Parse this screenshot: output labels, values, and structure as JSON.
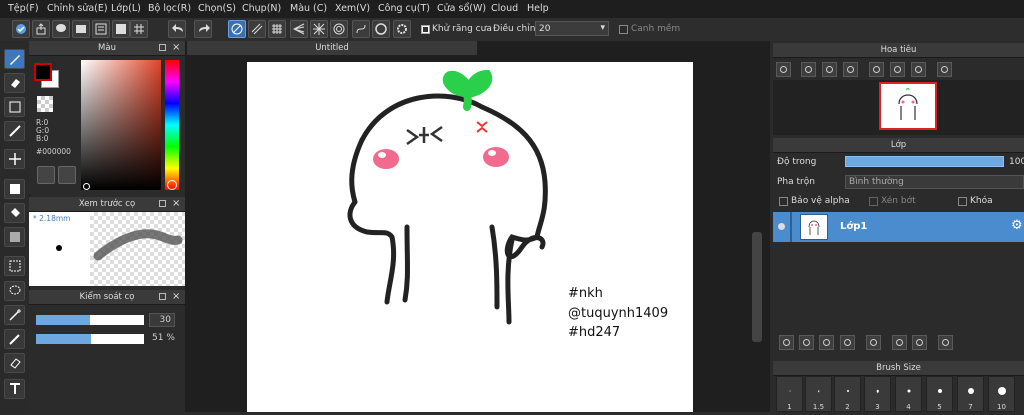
{
  "menu": [
    "Tệp(F)",
    "Chỉnh sửa(E)",
    "Lớp(L)",
    "Bộ lọc(R)",
    "Chọn(S)",
    "Chụp(N)",
    "Màu (C)",
    "Xem(V)",
    "Công cụ(T)",
    "Cửa sổ(W)",
    "Cloud",
    "Help"
  ],
  "toolbar": {
    "antialias_label": "Khử răng cưa",
    "correction_label": "Điều chỉnh",
    "correction_value": "20",
    "soft_edge_label": "Canh mềm"
  },
  "color_panel": {
    "title": "Màu",
    "r": "R:0",
    "g": "G:0",
    "b": "B:0",
    "hex": "#000000"
  },
  "brush_preview": {
    "title": "Xem trước cọ",
    "size": "2.18mm"
  },
  "brush_control": {
    "title": "Kiểm soát cọ",
    "size_value": "30",
    "size_fill": 0.5,
    "opacity_value": "51 %",
    "opacity_fill": 0.51
  },
  "document": {
    "tab_title": "Untitled",
    "text_line1": "#nkh",
    "text_line2": "@tuquynh1409",
    "text_line3": "#hd247"
  },
  "navigator": {
    "title": "Hoa tiêu"
  },
  "layers": {
    "title": "Lớp",
    "opacity_label": "Độ trong",
    "opacity_value": "100",
    "blend_label": "Pha trộn",
    "blend_value": "Bình thường",
    "protect_alpha": "Bảo vệ alpha",
    "clipping": "Xén bớt",
    "lock": "Khóa",
    "layer_name": "Lớp1"
  },
  "brush_size": {
    "title": "Brush Size",
    "sizes": [
      "1",
      "1.5",
      "2",
      "3",
      "4",
      "5",
      "7",
      "10"
    ]
  },
  "colors": {
    "accent": "#3b78c0",
    "layer_row": "#4a8ccd"
  }
}
